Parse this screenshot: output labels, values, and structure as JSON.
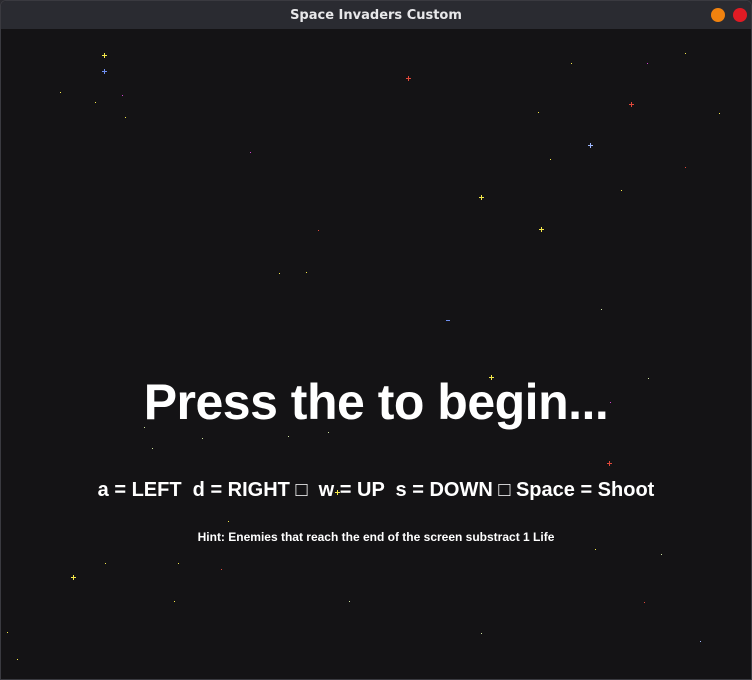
{
  "window": {
    "title": "Space Invaders Custom",
    "colors": {
      "minimize": "#f0820f",
      "close": "#e01b24",
      "titlebar": "#2a2b31",
      "background": "#141315"
    }
  },
  "screen": {
    "headline": "Press the to begin...",
    "controls": "a = LEFT  d = RIGHT □  w = UP  s = DOWN □ Space = Shoot",
    "hint": "Hint: Enemies that reach the end of the screen substract 1 Life"
  }
}
